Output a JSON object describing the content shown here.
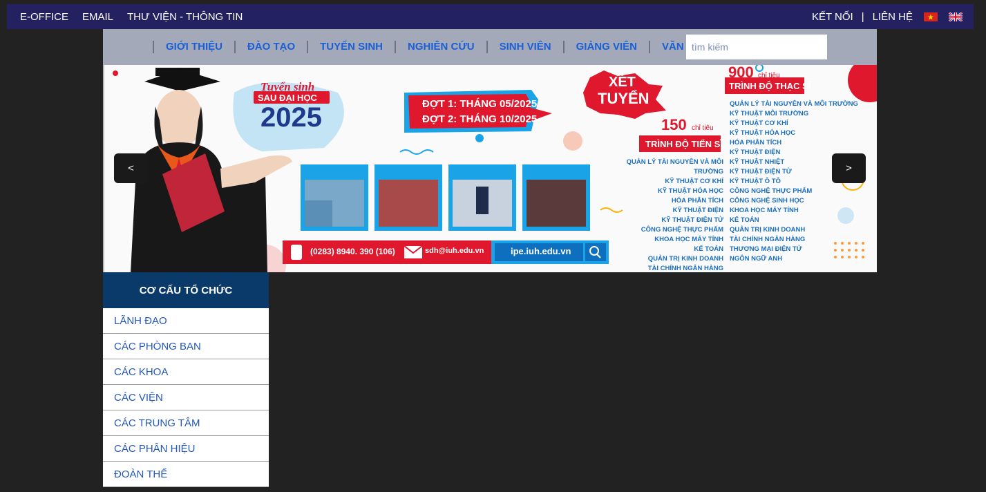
{
  "topbar": {
    "left_links": [
      "E-OFFICE",
      "EMAIL",
      "THƯ VIỆN - THÔNG TIN"
    ],
    "connect": "KẾT NỐI",
    "separator": "|",
    "contact": "LIÊN HỆ"
  },
  "mainnav": {
    "items": [
      "GIỚI THIỆU",
      "ĐÀO TẠO",
      "TUYỂN SINH",
      "NGHIÊN CỨU",
      "SINH VIÊN",
      "GIẢNG VIÊN",
      "VĂN BẰNG"
    ],
    "search_placeholder": "tìm kiếm"
  },
  "banner": {
    "prev_label": "<",
    "next_label": ">",
    "headline_script": "Tuyển sinh",
    "headline_program": "SAU ĐẠI HỌC",
    "headline_year": "2025",
    "round1": "ĐỢT 1: THÁNG 05/2025",
    "round2": "ĐỢT 2: THÁNG 10/2025",
    "xet": "XÉT",
    "tuyen": "TUYỂN",
    "phd_quota": "150",
    "phd_unit": "chỉ tiêu",
    "phd_title": "TRÌNH ĐỘ TIẾN SĨ",
    "phd_majors": [
      "QUẢN LÝ TÀI NGUYÊN VÀ MÔI TRƯỜNG",
      "KỸ THUẬT CƠ KHÍ",
      "KỸ THUẬT HÓA HỌC",
      "HÓA PHÂN TÍCH",
      "KỸ THUẬT ĐIỆN",
      "KỸ THUẬT ĐIỆN TỬ",
      "CÔNG NGHỆ THỰC PHẨM",
      "KHOA HỌC MÁY TÍNH",
      "KẾ TOÁN",
      "QUẢN TRỊ KINH DOANH",
      "TÀI CHÍNH NGÂN HÀNG"
    ],
    "master_quota": "900",
    "master_unit": "chỉ tiêu",
    "master_title": "TRÌNH ĐỘ THẠC SĨ",
    "master_majors": [
      "QUẢN LÝ TÀI NGUYÊN VÀ MÔI TRƯỜNG",
      "KỸ THUẬT MÔI TRƯỜNG",
      "KỸ THUẬT CƠ KHÍ",
      "KỸ THUẬT HÓA HỌC",
      "HÓA PHÂN TÍCH",
      "KỸ THUẬT ĐIỆN",
      "KỸ THUẬT NHIỆT",
      "KỸ THUẬT ĐIỆN TỬ",
      "KỸ THUẬT Ô TÔ",
      "CÔNG NGHỆ THỰC PHẨM",
      "CÔNG NGHỆ SINH HỌC",
      "KHOA HỌC MÁY TÍNH",
      "KẾ TOÁN",
      "QUẢN TRỊ KINH DOANH",
      "TÀI CHÍNH NGÂN HÀNG",
      "THƯƠNG MẠI ĐIỆN TỬ",
      "NGÔN NGỮ ANH"
    ],
    "phone": "(0283) 8940. 390 (106)",
    "email": "sdh@iuh.edu.vn",
    "website": "ipe.iuh.edu.vn"
  },
  "sidebar": {
    "title": "CƠ CẤU TỔ CHỨC",
    "items": [
      "LÃNH ĐẠO",
      "CÁC PHÒNG BAN",
      "CÁC KHOA",
      "CÁC VIỆN",
      "CÁC TRUNG TÂM",
      "CÁC PHÂN HIỆU",
      "ĐOÀN THỂ"
    ]
  },
  "colors": {
    "topbar_bg": "#23215f",
    "nav_bg": "#a3a9b8",
    "nav_link": "#1a5fd6",
    "sidebar_head": "#0a3a6a",
    "sidebar_link": "#2458b8",
    "page_bg": "#222222",
    "banner_red": "#e0182d",
    "banner_blue": "#1aa3e6"
  }
}
